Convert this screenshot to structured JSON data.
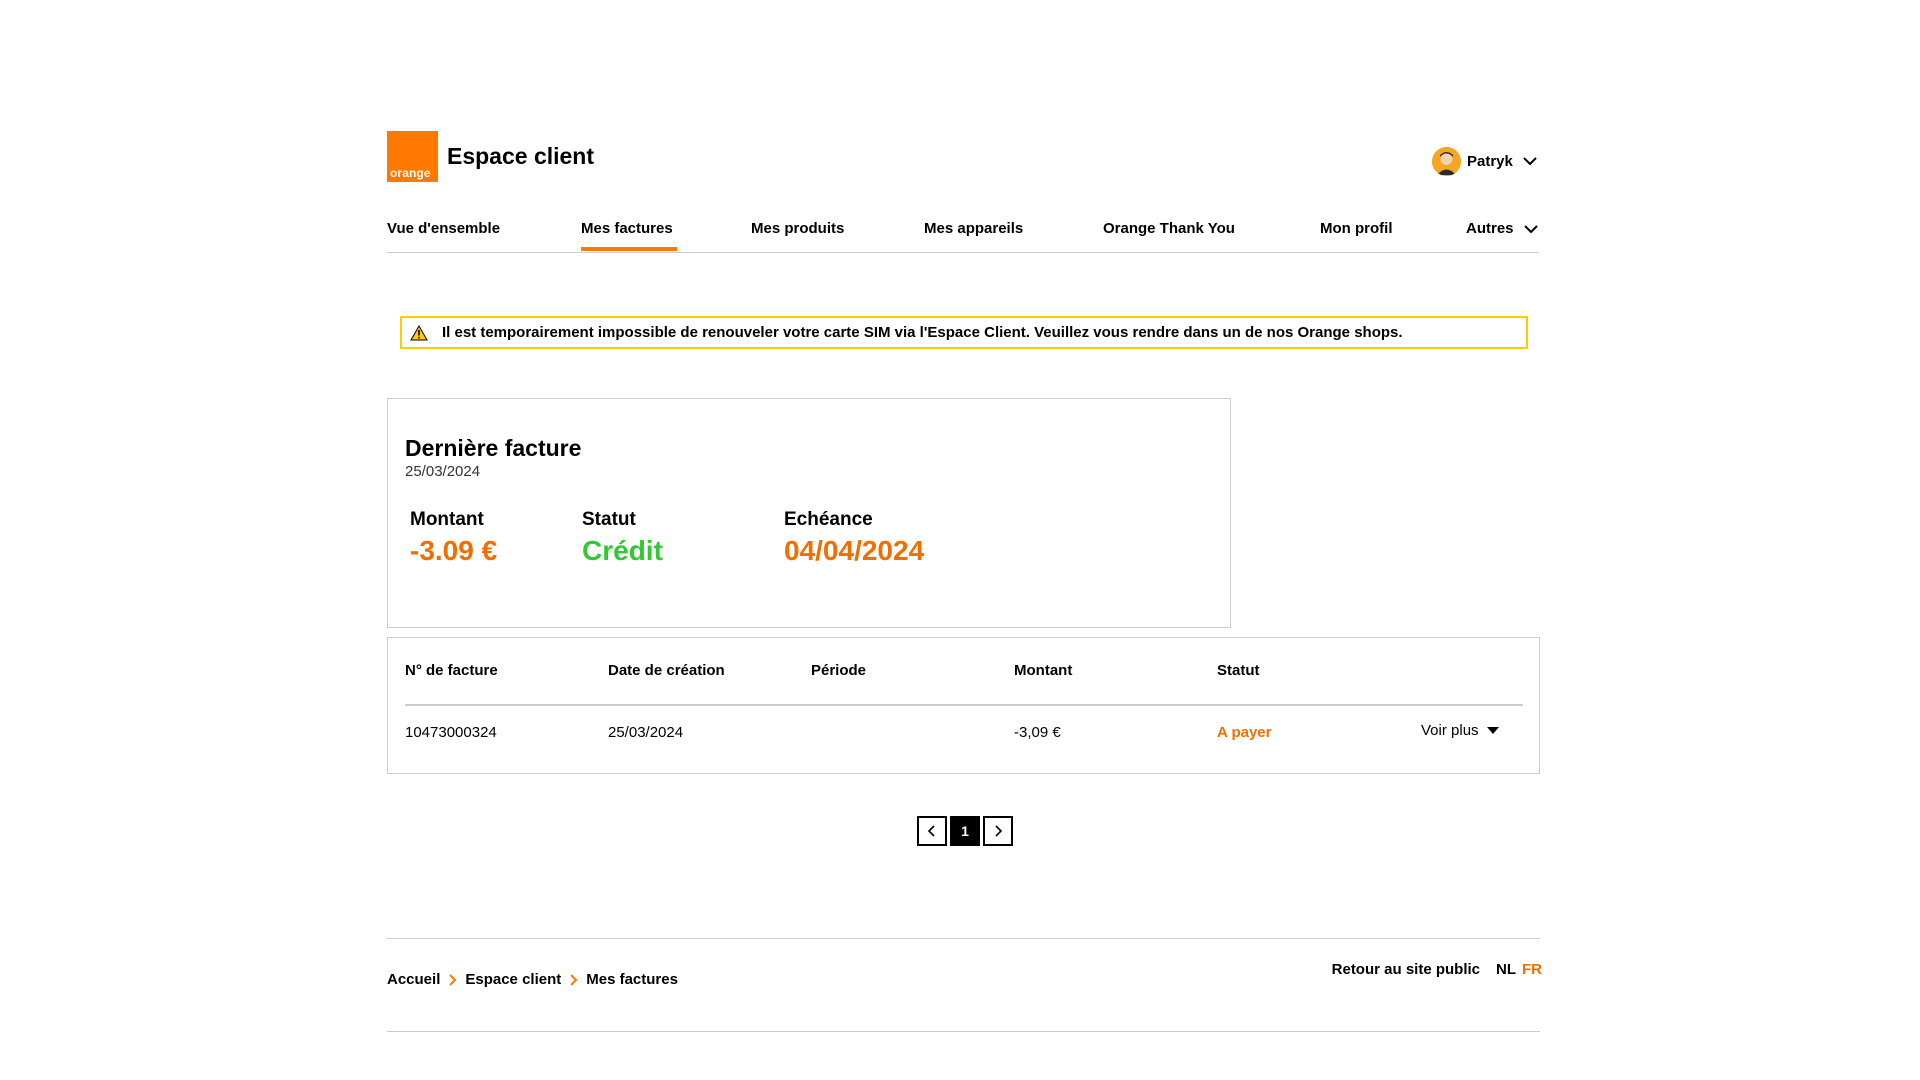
{
  "header": {
    "logo_text": "orange",
    "app_title": "Espace client",
    "user_name": "Patryk"
  },
  "nav": {
    "items": [
      {
        "label": "Vue d'ensemble"
      },
      {
        "label": "Mes factures"
      },
      {
        "label": "Mes produits"
      },
      {
        "label": "Mes appareils"
      },
      {
        "label": "Orange Thank You"
      },
      {
        "label": "Mon profil"
      },
      {
        "label": "Autres"
      }
    ],
    "active": "Mes factures"
  },
  "alert": {
    "icon": "warning-icon",
    "text": "Il est temporairement impossible de renouveler votre carte SIM via l'Espace Client. Veuillez vous rendre dans un de nos Orange shops."
  },
  "last_invoice": {
    "title": "Dernière facture",
    "date": "25/03/2024",
    "amount_label": "Montant",
    "amount_value": "-3.09 €",
    "status_label": "Statut",
    "status_value": "Crédit",
    "due_label": "Echéance",
    "due_value": "04/04/2024"
  },
  "invoices_table": {
    "headers": [
      "N° de facture",
      "Date de création",
      "Période",
      "Montant",
      "Statut"
    ],
    "rows": [
      {
        "number": "10473000324",
        "created": "25/03/2024",
        "period": "",
        "amount": "-3,09 €",
        "status": "A payer",
        "more": "Voir plus"
      }
    ]
  },
  "pagination": {
    "current_page": "1"
  },
  "footer": {
    "breadcrumb": [
      "Accueil",
      "Espace client",
      "Mes factures"
    ],
    "public_site_link": "Retour au site public",
    "lang_nl": "NL",
    "lang_fr": "FR"
  },
  "colors": {
    "brand": "#ff7900",
    "accent_text": "#f16e00",
    "credit_green": "#32c832",
    "alert_border": "#ffcc00"
  }
}
